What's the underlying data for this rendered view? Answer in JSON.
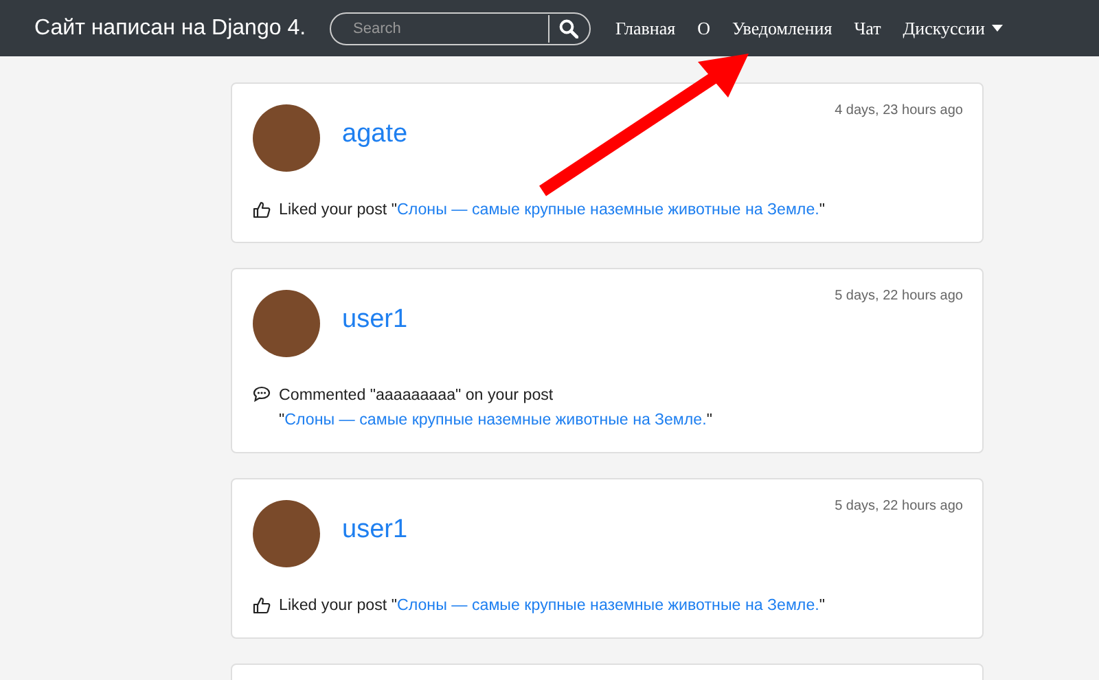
{
  "navbar": {
    "brand": "Сайт написан на Django 4.",
    "search": {
      "placeholder": "Search"
    },
    "links": [
      {
        "label": "Главная",
        "dropdown": false
      },
      {
        "label": "О",
        "dropdown": false
      },
      {
        "label": "Уведомления",
        "dropdown": false
      },
      {
        "label": "Чат",
        "dropdown": false
      },
      {
        "label": "Дискуссии",
        "dropdown": true
      }
    ]
  },
  "notifications": [
    {
      "kind": "like",
      "user": "agate",
      "time": "4 days, 23 hours ago",
      "prefix": "Liked your post \"",
      "link": "Слоны — самые крупные наземные животные на Земле.",
      "suffix": "\""
    },
    {
      "kind": "comment",
      "user": "user1",
      "time": "5 days, 22 hours ago",
      "prefix": "Commented \"ааааааааа\" on your post \"",
      "link": "Слоны — самые крупные наземные животные на",
      "link_2": "Земле.",
      "suffix": "\""
    },
    {
      "kind": "like",
      "user": "user1",
      "time": "5 days, 22 hours ago",
      "prefix": "Liked your post \"",
      "link": "Слоны — самые крупные наземные животные на Земле.",
      "suffix": "\""
    }
  ]
}
